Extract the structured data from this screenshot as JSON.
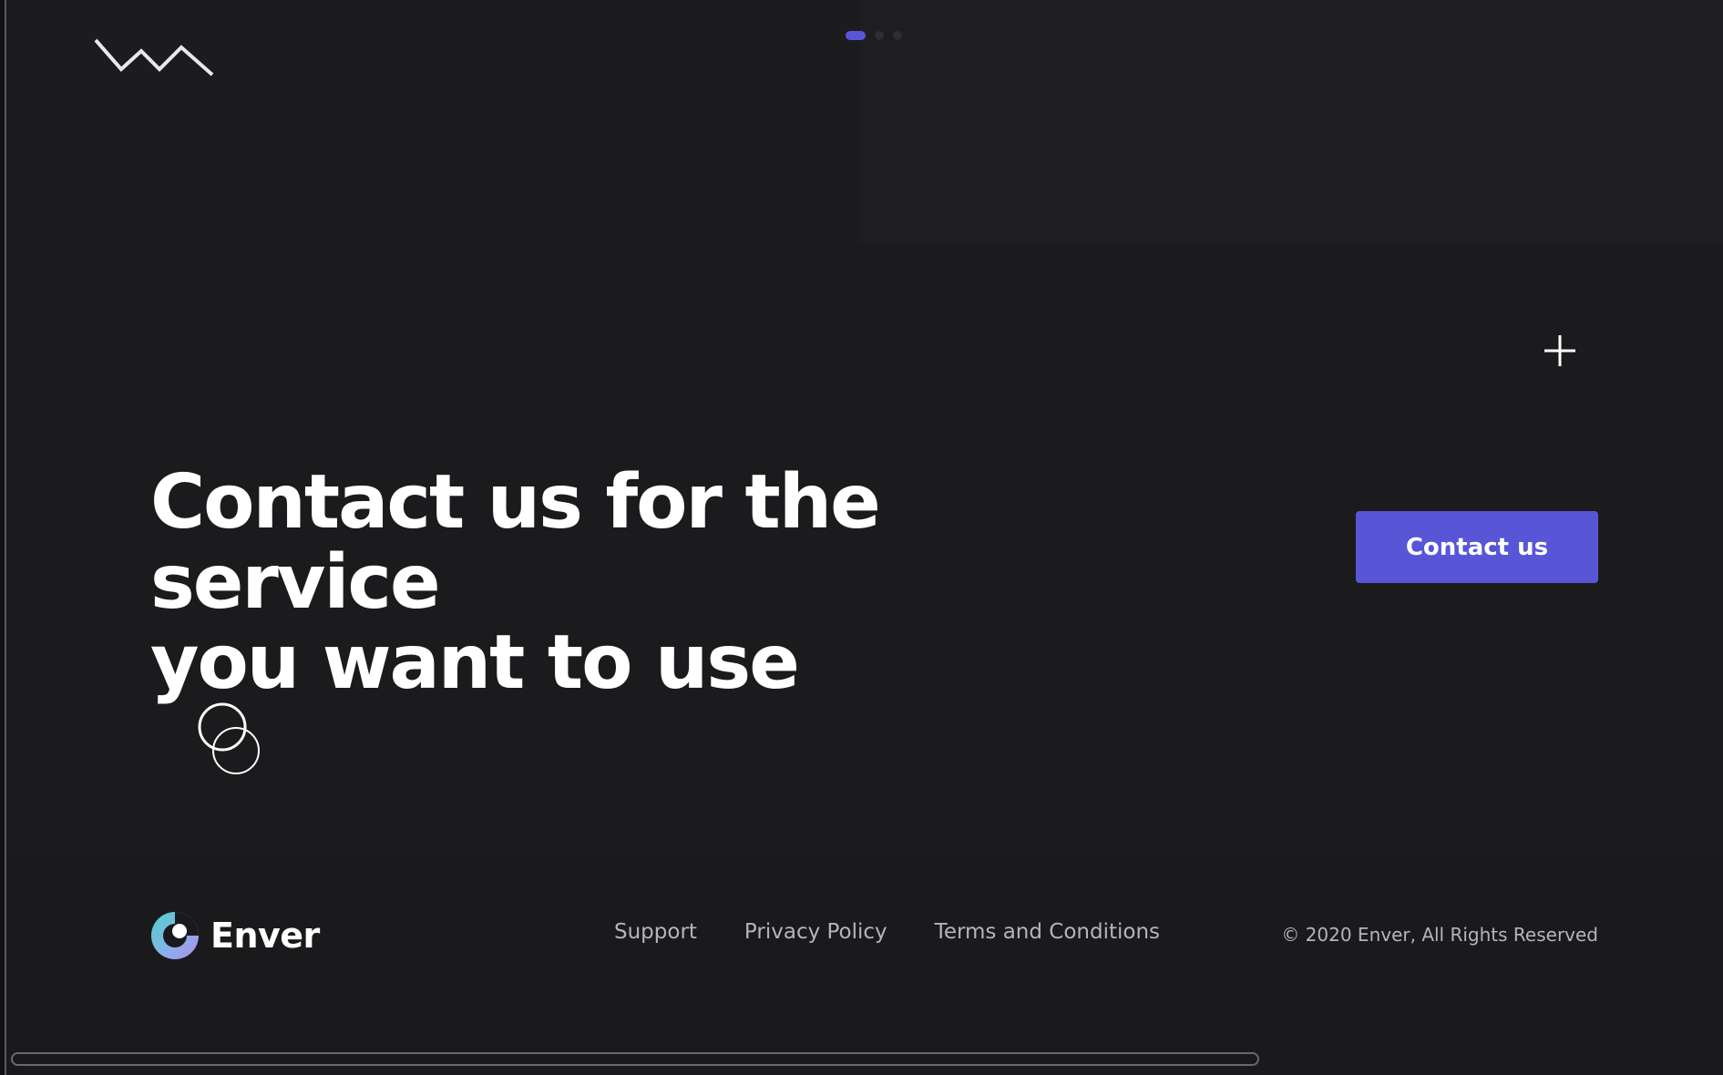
{
  "hero": {
    "headline_line1": "Contact us for the service",
    "headline_line2": "you want to use",
    "cta_label": "Contact us"
  },
  "slider": {
    "count": 3,
    "active_index": 0
  },
  "icons": {
    "top_logo": "zigzag-icon",
    "expand": "plus-icon",
    "decoration": "overlapping-circles-icon",
    "brand_logo": "enver-logo-icon"
  },
  "footer": {
    "brand_name": "Enver",
    "links": [
      {
        "label": "Support"
      },
      {
        "label": "Privacy Policy"
      },
      {
        "label": "Terms and Conditions"
      }
    ],
    "copyright": "© 2020 Enver, All Rights Reserved"
  },
  "colors": {
    "background": "#1b1b1d",
    "accent": "#5856d6",
    "text_primary": "#ffffff",
    "text_secondary": "#b4b4ba"
  }
}
